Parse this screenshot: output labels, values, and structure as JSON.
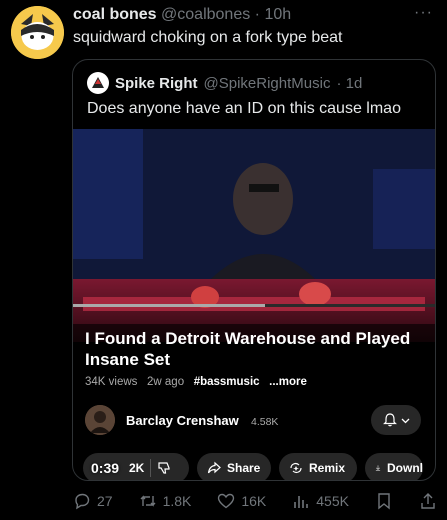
{
  "tweet": {
    "display_name": "coal bones",
    "handle": "@coalbones",
    "time": "· 10h",
    "text": "squidward choking on a fork type beat",
    "more": "···"
  },
  "quote": {
    "display_name": "Spike Right",
    "handle": "@SpikeRightMusic",
    "time": "· 1d",
    "text": "Does anyone have an ID on this cause lmao"
  },
  "video": {
    "title": "I Found a Detroit Warehouse and Played Insane Set",
    "views": "34K views",
    "age": "2w ago",
    "hashtag": "#bassmusic",
    "more": "...more",
    "timestamp": "0:39",
    "progress": 0.53,
    "channel_name": "Barclay Crenshaw",
    "channel_subs": "4.58K",
    "likes": "2K",
    "share": "Share",
    "remix": "Remix",
    "download": "Downl"
  },
  "stats": {
    "replies": "27",
    "reposts": "1.8K",
    "likes": "16K",
    "views": "455K"
  },
  "colors": {
    "background": "#000000",
    "text": "#e7e9ea",
    "muted": "#71767b",
    "border": "#2f3336",
    "pill": "#272727",
    "avatar": "#f6c94c"
  }
}
